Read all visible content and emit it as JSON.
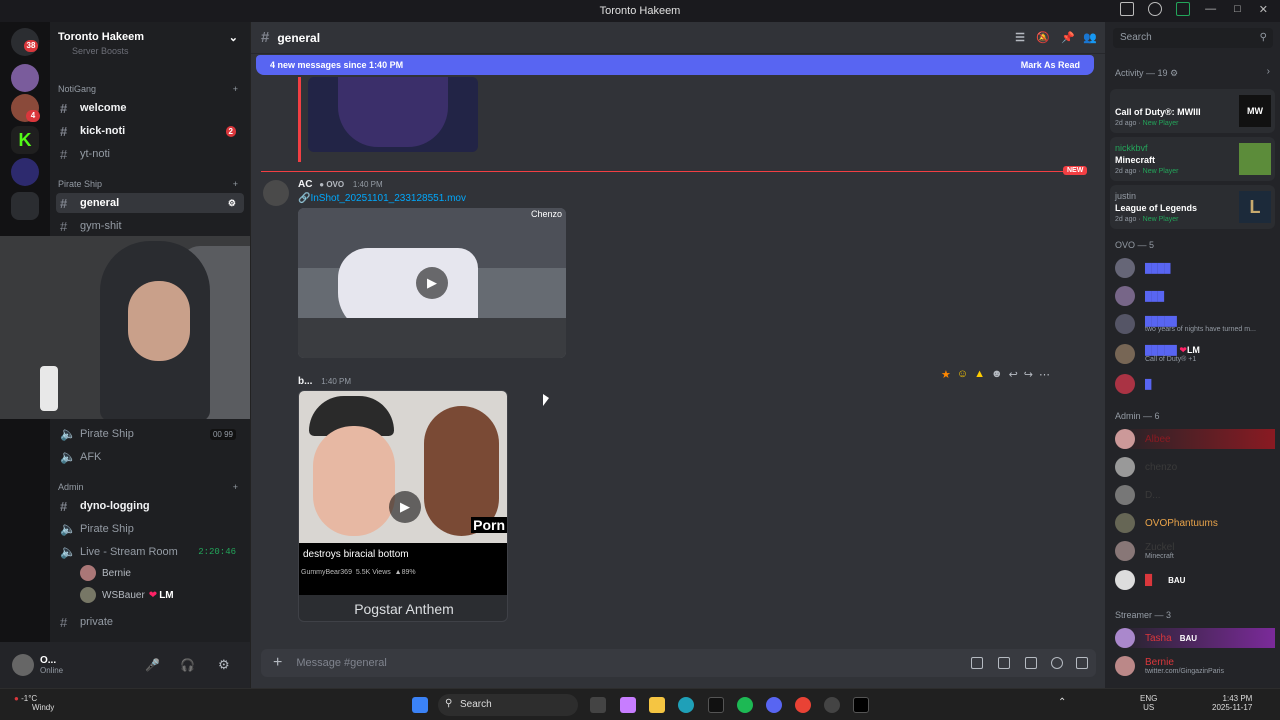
{
  "window": {
    "title": "Toronto Hakeem"
  },
  "rail": {
    "top_badge": "38",
    "badge_2": "4"
  },
  "sidebar": {
    "server_name": "Toronto Hakeem",
    "cut_off_item": "Server Boosts",
    "categories": {
      "notigang": "NotiGang",
      "pirate": "Pirate Ship",
      "admin": "Admin"
    },
    "channels": {
      "welcome": "welcome",
      "kick_noti": "kick-noti",
      "kick_noti_badge": "2",
      "yt_noti": "yt-noti",
      "general": "general",
      "gym": "gym-shit",
      "voice_pirate": "Pirate Ship",
      "voice_pirate_count_a": "00",
      "voice_pirate_count_b": "99",
      "voice_afk": "AFK",
      "dyno": "dyno-logging",
      "admin_pirate": "Pirate Ship",
      "live_stream": "Live - Stream Room",
      "live_timer": "2:20:46",
      "private": "private"
    },
    "voice_users": {
      "bernie": "Bernie",
      "wsbauer": "WSBauer",
      "wsbauer_tag": "LM"
    },
    "user": {
      "name": "O...",
      "status": "Online"
    }
  },
  "chat": {
    "channel": "general",
    "new_messages": "4 new messages since 1:40 PM",
    "mark_read": "Mark As Read",
    "new_tag": "NEW",
    "msg1": {
      "author": "AC",
      "tag": "OVO",
      "time": "1:40 PM",
      "attachment": "InShot_20251101_233128551.mov",
      "watermark": "Chenzo"
    },
    "msg2": {
      "author": "b...",
      "time": "1:40 PM",
      "caption": "destroys biracial bottom",
      "meta_user": "GummyBear369",
      "meta_views": "5.5K Views",
      "meta_pct": "89%",
      "logo": "Porn",
      "subtitle": "Pogstar Anthem"
    },
    "composer_placeholder": "Message #general"
  },
  "members": {
    "search_placeholder": "Search",
    "activity_header": "Activity — 19",
    "activity": [
      {
        "user": "",
        "game": "Call of Duty®: MWIII",
        "meta": "2d ago",
        "tag": "New Player"
      },
      {
        "user": "nickkbvf",
        "game": "Minecraft",
        "meta": "2d ago",
        "tag": "New Player"
      },
      {
        "user": "justin",
        "game": "League of Legends",
        "meta": "2d ago",
        "tag": "New Player"
      }
    ],
    "ovo_header": "OVO — 5",
    "ovo_status": "two years of nights have turned m...",
    "ovo_lm": "LM",
    "ovo_game": "Call of Duty® +1",
    "admin_header": "Admin — 6",
    "admin_names": {
      "a1": "Albee",
      "a2": "chenzo",
      "a3": "D...",
      "a4": "OVOPhantuums",
      "a5": "Zuckel",
      "a5_game": "Minecraft",
      "a6_tag": "BAU"
    },
    "streamer_header": "Streamer — 3",
    "streamers": {
      "s1": "Tasha",
      "s1_tag": "BAU",
      "s2": "Bernie",
      "s2_status": "twitter.com/GingazinParis"
    }
  },
  "taskbar": {
    "weather_temp": "-1°C",
    "weather_desc": "Windy",
    "search": "Search",
    "lang": "ENG",
    "region": "US",
    "time": "1:43 PM",
    "date": "2025-11-17"
  },
  "colors": {
    "blurple": "#5865f2",
    "red": "#da373c",
    "link": "#00a8fc",
    "green": "#23a55a"
  }
}
